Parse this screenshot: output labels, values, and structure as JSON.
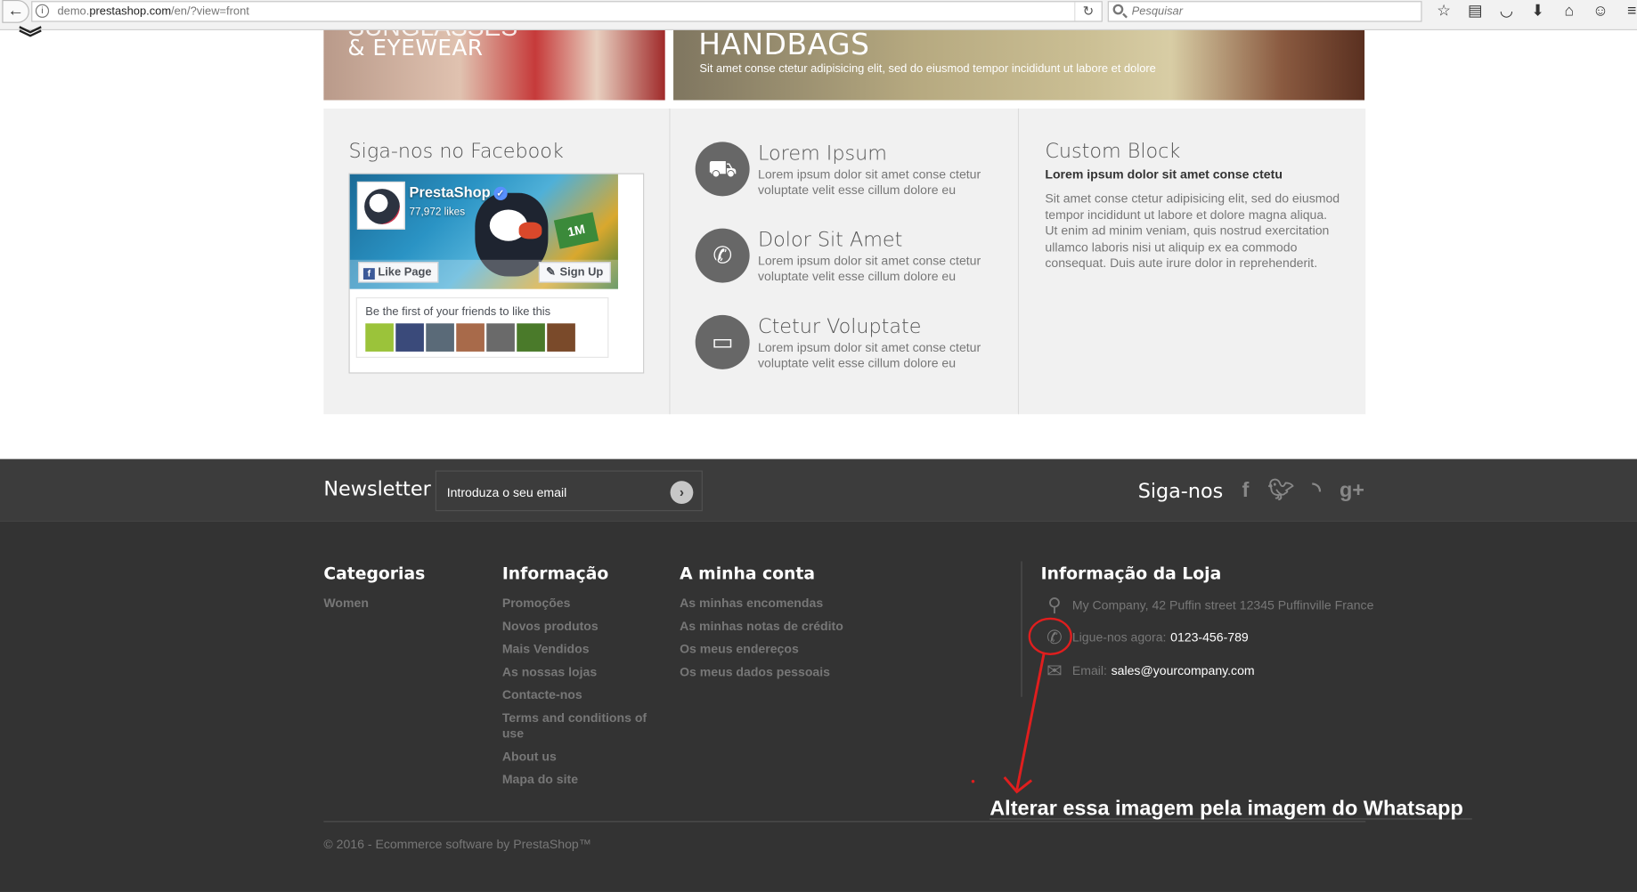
{
  "browser": {
    "url_prefix": "demo.",
    "url_domain": "prestashop.com",
    "url_path": "/en/?view=front",
    "search_placeholder": "Pesquisar"
  },
  "banners": {
    "left_ghost": "SUNGLASSES",
    "left_title": "& EYEWEAR",
    "right_title": "HANDBAGS",
    "right_subtitle": "Sit amet conse ctetur adipisicing elit, sed do eiusmod tempor incididunt ut labore et dolore"
  },
  "facebook": {
    "title": "Siga-nos no Facebook",
    "page_name": "PrestaShop",
    "likes": "77,972 likes",
    "like_button": "Like Page",
    "signup_button": "Sign Up",
    "friends_text": "Be the first of your friends to like this",
    "cover_badge": "1M"
  },
  "features": [
    {
      "icon": "truck-icon",
      "title": "Lorem Ipsum",
      "text": "Lorem ipsum dolor sit amet conse ctetur voluptate velit esse cillum dolore eu"
    },
    {
      "icon": "phone-icon",
      "title": "Dolor Sit Amet",
      "text": "Lorem ipsum dolor sit amet conse ctetur voluptate velit esse cillum dolore eu"
    },
    {
      "icon": "credit-card-icon",
      "title": "Ctetur Voluptate",
      "text": "Lorem ipsum dolor sit amet conse ctetur voluptate velit esse cillum dolore eu"
    }
  ],
  "custom_block": {
    "title": "Custom Block",
    "subtitle": "Lorem ipsum dolor sit amet conse ctetu",
    "text": "Sit amet conse ctetur adipisicing elit, sed do eiusmod tempor incididunt ut labore et dolore magna aliqua. Ut enim ad minim veniam, quis nostrud exercitation ullamco laboris nisi ut aliquip ex ea commodo consequat. Duis aute irure dolor in reprehenderit."
  },
  "newsletter": {
    "title": "Newsletter",
    "input_value": "Introduza o seu email",
    "social_title": "Siga-nos"
  },
  "footer": {
    "categories": {
      "title": "Categorias",
      "links": [
        "Women"
      ]
    },
    "information": {
      "title": "Informação",
      "links": [
        "Promoções",
        "Novos produtos",
        "Mais Vendidos",
        "As nossas lojas",
        "Contacte-nos",
        "Terms and conditions of use",
        "About us",
        "Mapa do site"
      ]
    },
    "account": {
      "title": "A minha conta",
      "links": [
        "As minhas encomendas",
        "As minhas notas de crédito",
        "Os meus endereços",
        "Os meus dados pessoais"
      ]
    },
    "store": {
      "title": "Informação da Loja",
      "address": "My Company, 42 Puffin street 12345 Puffinville France",
      "phone_label": "Ligue-nos agora:",
      "phone_value": "0123-456-789",
      "email_label": "Email:",
      "email_value": "sales@yourcompany.com"
    },
    "copyright": "© 2016 - Ecommerce software by PrestaShop™"
  },
  "annotation": {
    "text": "Alterar essa imagem pela imagem do Whatsapp",
    "color": "#e01e1e"
  }
}
